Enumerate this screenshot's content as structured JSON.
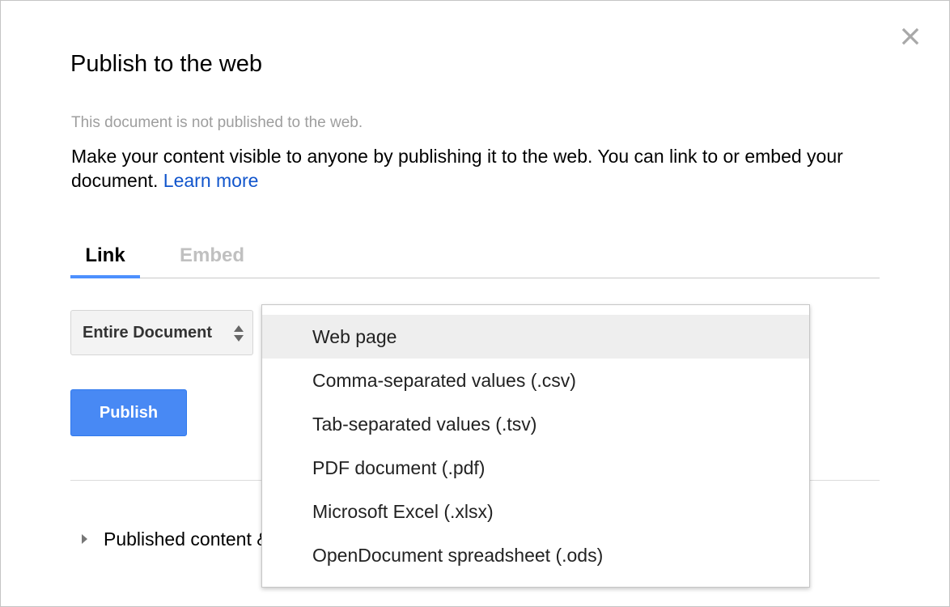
{
  "dialog": {
    "title": "Publish to the web",
    "status_text": "This document is not published to the web.",
    "description": "Make your content visible to anyone by publishing it to the web. You can link to or embed your document.",
    "learn_more_label": "Learn more",
    "close_icon": "close-icon"
  },
  "tabs": [
    {
      "label": "Link",
      "active": true
    },
    {
      "label": "Embed",
      "active": false
    }
  ],
  "scope_select": {
    "value": "Entire Document",
    "icon": "sort-arrows-icon"
  },
  "publish_button_label": "Publish",
  "published_content_label": "Published content & settings",
  "format_dropdown": {
    "selected": "Web page",
    "options": [
      "Web page",
      "Comma-separated values (.csv)",
      "Tab-separated values (.tsv)",
      "PDF document (.pdf)",
      "Microsoft Excel (.xlsx)",
      "OpenDocument spreadsheet (.ods)"
    ]
  },
  "colors": {
    "accent_blue": "#4d90fe",
    "publish_button": "#4889f4",
    "link": "#1155cc"
  }
}
